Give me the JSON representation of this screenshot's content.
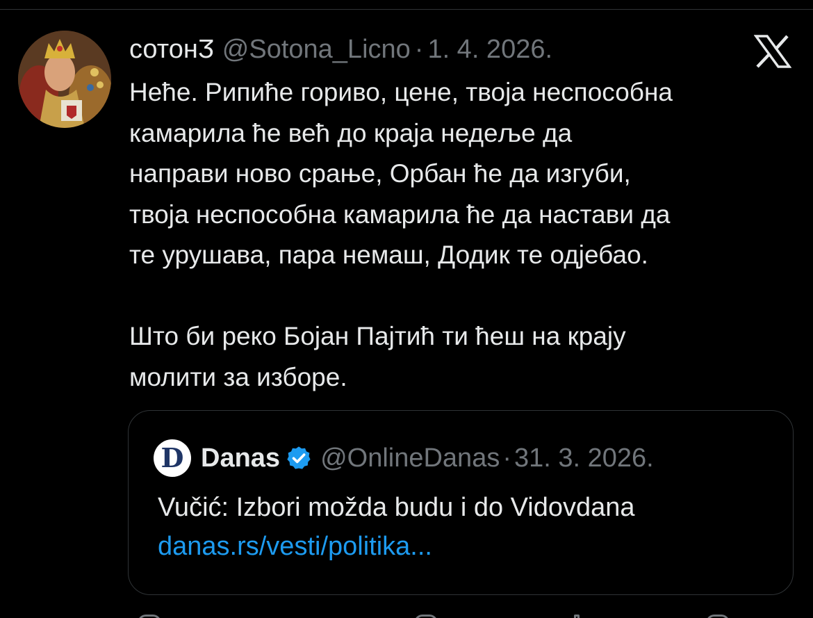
{
  "tweet": {
    "display_name": "сотонӠ",
    "handle": "@Sotona_Licno",
    "separator": "·",
    "date": "1. 4. 2026.",
    "text": "Неће. Рипиће гориво, цене, твоја неспособна\nкамарила ће већ до краја недеље да\nнаправи ново срање, Орбан ће да изгуби,\nтвоја неспособна камарила ће да настави да\nте урушава, пара немаш, Додик те одјебао.\n\nШто би реко Бојан Пајтић ти ћеш на крају\nмолити за изборе."
  },
  "quote": {
    "avatar_letter": "D",
    "display_name": "Danas",
    "handle": "@OnlineDanas",
    "separator": "·",
    "date": "31. 3. 2026.",
    "text": "Vučić: Izbori možda budu i do Vidovdana",
    "link": "danas.rs/vesti/politika..."
  },
  "icons": {
    "avatar": "profile-avatar",
    "platform": "x-logo-icon",
    "verified": "verified-badge-icon"
  },
  "colors": {
    "background": "#000000",
    "text": "#e7e9ea",
    "secondary": "#71767b",
    "link": "#1d9bf0",
    "verified": "#1d9bf0",
    "border": "#2f3336"
  }
}
